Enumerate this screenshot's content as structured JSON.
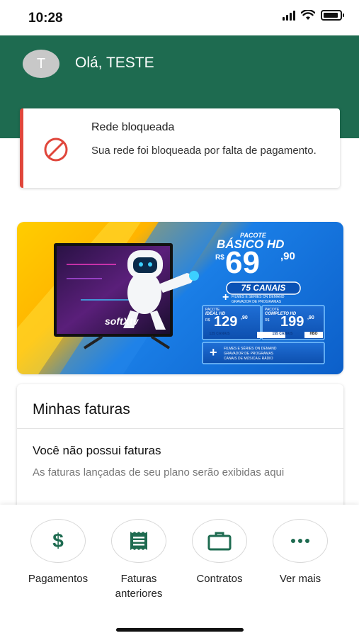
{
  "status_bar": {
    "time": "10:28"
  },
  "header": {
    "avatar_initial": "T",
    "greeting": "Olá, TESTE"
  },
  "alert": {
    "title": "Rede bloqueada",
    "message": "Sua rede foi bloqueada por falta de pagamento."
  },
  "banner": {
    "pacote_label": "PACOTE",
    "pacote_name": "BÁSICO HD",
    "currency": "R$",
    "price_main": "69",
    "price_cents": ",90",
    "channels": "75 CANAIS",
    "extra_1": "FILMES E SÉRIES ON DEMAND",
    "extra_2": "GRAVADOR DE PROGRAMAS",
    "brand": "softXtv",
    "plan_a": {
      "label": "PACOTE",
      "name": "IDEAL HD",
      "currency": "R$",
      "price": "129",
      "cents": ",90",
      "channels": "125 CANAIS"
    },
    "plan_b": {
      "label": "PACOTE",
      "name": "COMPLETO HD",
      "currency": "R$",
      "price": "199",
      "cents": ",90",
      "channels": "155 CANAIS",
      "badge": "HBO"
    },
    "bottom_1": "FILMES E SÉRIES ON DEMAND",
    "bottom_2": "GRAVADOR DE PROGRAMAS",
    "bottom_3": "CANAIS DE MÚSICA E RÁDIO"
  },
  "invoices": {
    "title": "Minhas faturas",
    "empty_title": "Você não possui faturas",
    "empty_text": "As faturas lançadas de seu plano serão exibidas aqui"
  },
  "nav": {
    "items": [
      {
        "label": "Pagamentos",
        "icon": "dollar-icon"
      },
      {
        "label": "Faturas anteriores",
        "icon": "receipt-icon"
      },
      {
        "label": "Contratos",
        "icon": "briefcase-icon"
      },
      {
        "label": "Ver mais",
        "icon": "more-dots-icon"
      }
    ]
  },
  "colors": {
    "primary": "#1e6b50",
    "alert": "#e0463b",
    "banner_blue": "#1a7ee6",
    "banner_yellow": "#ffcd00"
  }
}
